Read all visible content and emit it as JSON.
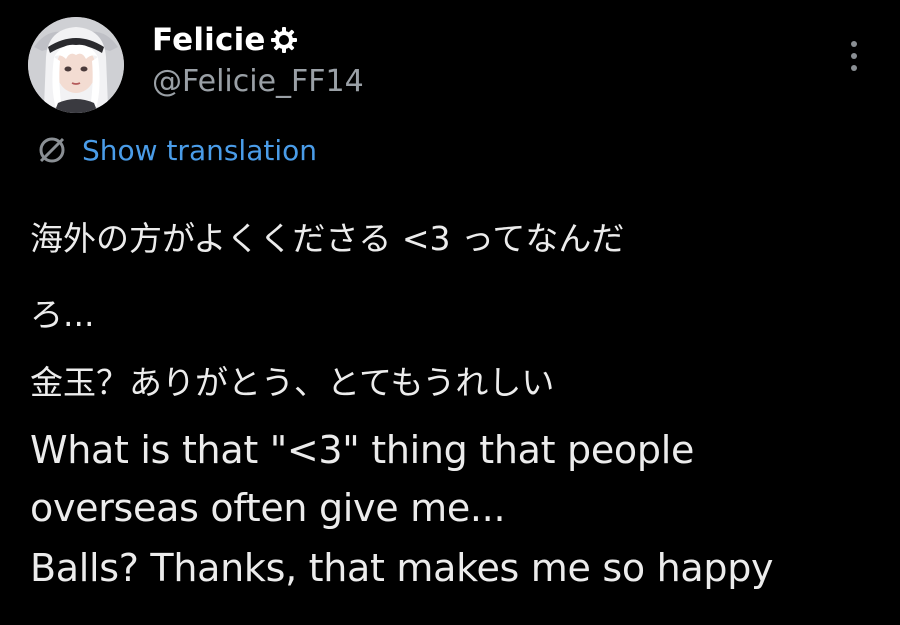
{
  "user": {
    "display_name": "Felicie",
    "handle": "@Felicie_FF14",
    "badge_icon": "gear-badge-icon",
    "avatar": "avatar-image"
  },
  "menu_icon": "more-vertical-icon",
  "translate": {
    "icon": "translate-icon",
    "label": "Show translation",
    "color": "#4a9ce8"
  },
  "post": {
    "jp_line1": "海外の方がよくくださる <3 ってなんだ",
    "jp_line2": "ろ...",
    "jp_line3": "金玉？ありがとう、とてもうれしい",
    "en_line1": "What is that \"<3\" thing that people",
    "en_line2": "overseas often give me...",
    "en_line3": "Balls? Thanks, that makes me so happy"
  },
  "colors": {
    "background": "#000000",
    "text": "#ececec",
    "handle": "#9aa0a6",
    "link": "#4a9ce8"
  }
}
